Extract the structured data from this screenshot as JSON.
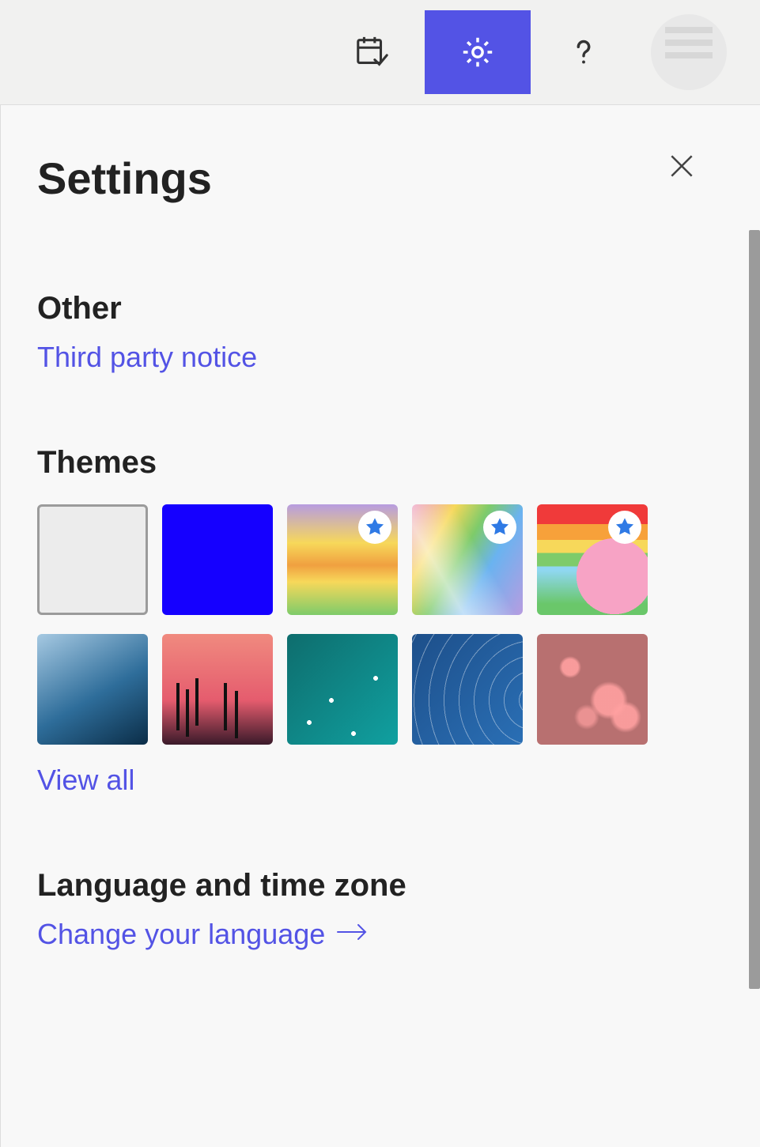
{
  "topbar": {
    "icons": [
      "calendar-check",
      "settings",
      "help"
    ],
    "active_index": 1
  },
  "panel": {
    "title": "Settings",
    "sections": {
      "other": {
        "heading": "Other",
        "link": "Third party notice"
      },
      "themes": {
        "heading": "Themes",
        "view_all": "View all",
        "items": [
          {
            "id": "default",
            "premium": false,
            "selected": true
          },
          {
            "id": "blue",
            "premium": false,
            "selected": false
          },
          {
            "id": "rainbow",
            "premium": true,
            "selected": false
          },
          {
            "id": "ribbons",
            "premium": true,
            "selected": false
          },
          {
            "id": "unicorn",
            "premium": true,
            "selected": false
          },
          {
            "id": "mountain",
            "premium": false,
            "selected": false
          },
          {
            "id": "sunset",
            "premium": false,
            "selected": false
          },
          {
            "id": "circuit",
            "premium": false,
            "selected": false
          },
          {
            "id": "blueprint",
            "premium": false,
            "selected": false
          },
          {
            "id": "bokeh",
            "premium": false,
            "selected": false
          }
        ]
      },
      "language": {
        "heading": "Language and time zone",
        "link": "Change your language"
      }
    }
  }
}
